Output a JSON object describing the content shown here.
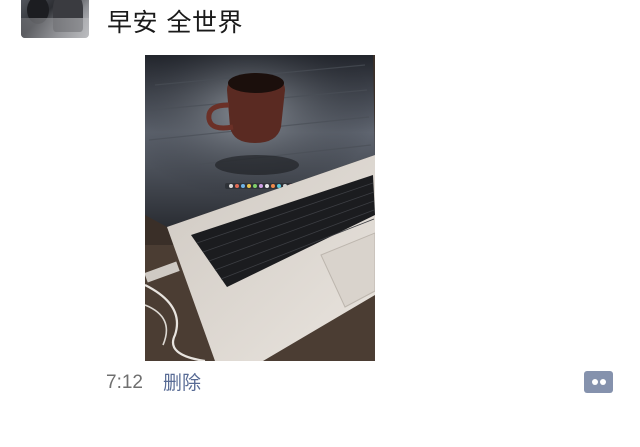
{
  "post": {
    "author_avatar": "avatar-photo",
    "text": "早安 全世界",
    "image": "laptop-and-coffee-cup-photo",
    "time": "7:12",
    "delete_label": "删除",
    "comment_icon": "comment-dots-icon"
  },
  "colors": {
    "text": "#1a1a1a",
    "time": "#6f6f6f",
    "link": "#586b95",
    "comment_button": "#8592ad"
  }
}
